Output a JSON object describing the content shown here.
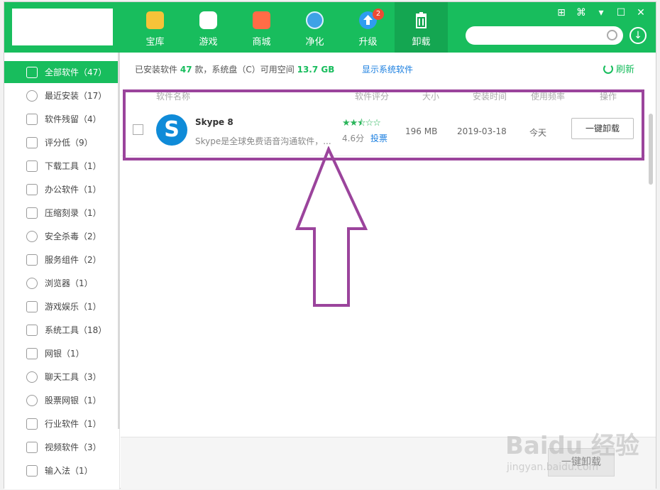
{
  "nav": [
    {
      "label": "宝库",
      "icon": "star-icon"
    },
    {
      "label": "游戏",
      "icon": "gamepad-icon"
    },
    {
      "label": "商城",
      "icon": "shopping-bag-icon"
    },
    {
      "label": "净化",
      "icon": "fan-icon"
    },
    {
      "label": "升级",
      "icon": "upgrade-arrow-icon",
      "badge": "2"
    },
    {
      "label": "卸载",
      "icon": "trash-icon"
    }
  ],
  "window_controls": [
    "⊞",
    "⌘",
    "▾",
    "☐",
    "✕"
  ],
  "sidebar": {
    "items": [
      {
        "label": "全部软件（47）"
      },
      {
        "label": "最近安装（17）"
      },
      {
        "label": "软件残留（4）"
      },
      {
        "label": "评分低（9）"
      },
      {
        "label": "下载工具（1）"
      },
      {
        "label": "办公软件（1）"
      },
      {
        "label": "压缩刻录（1）"
      },
      {
        "label": "安全杀毒（2）"
      },
      {
        "label": "服务组件（2）"
      },
      {
        "label": "浏览器（1）"
      },
      {
        "label": "游戏娱乐（1）"
      },
      {
        "label": "系统工具（18）"
      },
      {
        "label": "网银（1）"
      },
      {
        "label": "聊天工具（3）"
      },
      {
        "label": "股票网银（1）"
      },
      {
        "label": "行业软件（1）"
      },
      {
        "label": "视频软件（3）"
      },
      {
        "label": "输入法（1）"
      }
    ]
  },
  "info": {
    "prefix": "已安装软件",
    "count": "47",
    "mid": "款，系统盘（C）可用空间",
    "space": "13.7 GB"
  },
  "show_system": "显示系统软件",
  "refresh": "刷新",
  "columns": [
    "软件名称",
    "软件评分",
    "大小",
    "安装时间",
    "使用频率",
    "操作"
  ],
  "row": {
    "name": "Skype 8",
    "desc": "Skype是全球免费语音沟通软件，...",
    "stars": "★★⯪☆☆",
    "score": "4.6分",
    "vote": "投票",
    "size": "196 MB",
    "date": "2019-03-18",
    "freq": "今天",
    "button": "一键卸载"
  },
  "bottom_button": "一键卸载",
  "watermark": "Baidu 经验",
  "watermark_sub": "jingyan.baidu.com",
  "colors": {
    "brand": "#18bd5d",
    "annotation": "#9b449c"
  }
}
